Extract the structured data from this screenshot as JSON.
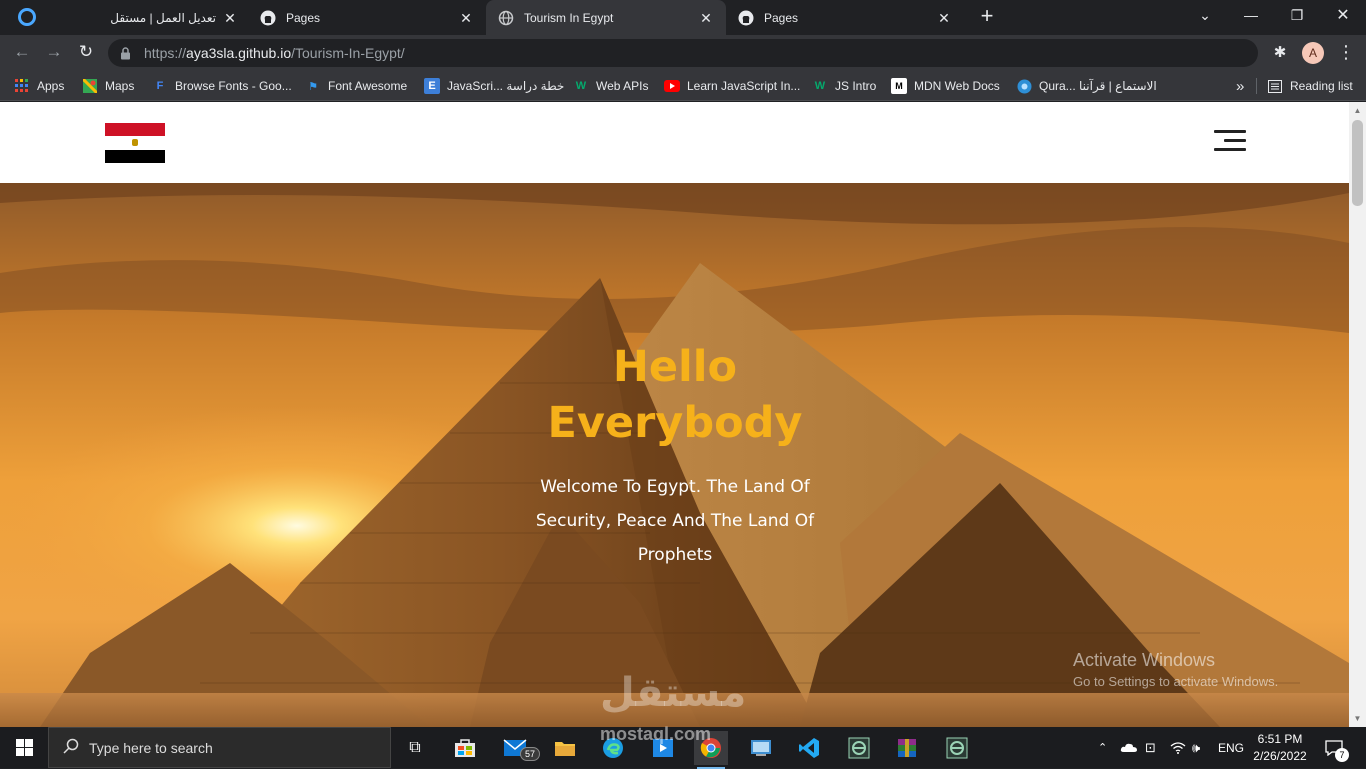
{
  "browser": {
    "tabs": [
      {
        "title": "تعديل العمل | مستقل",
        "icon": "mostaql-icon",
        "active": false
      },
      {
        "title": "Pages",
        "icon": "github-icon",
        "active": false
      },
      {
        "title": "Tourism In Egypt",
        "icon": "globe-icon",
        "active": true
      },
      {
        "title": "Pages",
        "icon": "github-icon",
        "active": false
      }
    ],
    "new_tab": "+",
    "url_protocol": "https://",
    "url_host": "aya3sla.github.io",
    "url_path": "/Tourism-In-Egypt/",
    "profile_initial": "A",
    "bookmarks": [
      {
        "label": "Apps",
        "icon": "apps-grid-icon"
      },
      {
        "label": "Maps",
        "icon": "maps-icon"
      },
      {
        "label": "Browse Fonts - Goo...",
        "icon": "google-fonts-icon"
      },
      {
        "label": "Font Awesome",
        "icon": "flag-icon"
      },
      {
        "label": "JavaScri... خطة دراسة",
        "icon": "e-icon"
      },
      {
        "label": "Web APIs",
        "icon": "w3-icon"
      },
      {
        "label": "Learn JavaScript In...",
        "icon": "youtube-icon"
      },
      {
        "label": "JS Intro",
        "icon": "w3-icon"
      },
      {
        "label": "MDN Web Docs",
        "icon": "mdn-icon"
      },
      {
        "label": "Qura... الاستماع | قرآننا",
        "icon": "quran-icon"
      }
    ],
    "bookmarks_more": "»",
    "reading_list": "Reading list"
  },
  "page": {
    "logo": "egypt-flag",
    "hero": {
      "title_line1": "Hello",
      "title_line2": "Everybody",
      "subtitle": "Welcome To Egypt. The Land Of Security, Peace And The Land Of Prophets"
    },
    "watermark": "mostaql.com",
    "watermark_ar": "مستقل"
  },
  "windows": {
    "activate_title": "Activate Windows",
    "activate_sub": "Go to Settings to activate Windows."
  },
  "taskbar": {
    "search_placeholder": "Type here to search",
    "mail_badge": "57",
    "language": "ENG",
    "time": "6:51 PM",
    "date": "2/26/2022",
    "notification_count": "7"
  },
  "colors": {
    "hero_title": "#f6b11a",
    "tab_active": "#35363a",
    "titlebar": "#202124"
  }
}
